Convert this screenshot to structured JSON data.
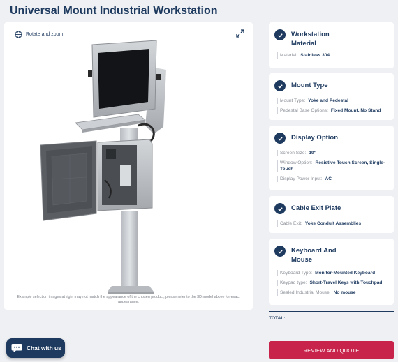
{
  "page": {
    "title": "Universal Mount Industrial Workstation"
  },
  "viewer": {
    "rotate_label": "Rotate and zoom",
    "disclaimer": "Example selection images at right may not match the appearance of the chosen product, please refer to the 3D model above for exact appearance."
  },
  "sections": [
    {
      "title": "Workstation Material",
      "rows": [
        {
          "label": "Material:",
          "value": "Stainless 304"
        }
      ]
    },
    {
      "title": "Mount Type",
      "rows": [
        {
          "label": "Mount Type:",
          "value": "Yoke and Pedestal"
        },
        {
          "label": "Pedestal Base Options:",
          "value": "Fixed Mount, No Stand"
        }
      ]
    },
    {
      "title": "Display Option",
      "rows": [
        {
          "label": "Screen Size:",
          "value": "19\""
        },
        {
          "label": "Window Option:",
          "value": "Resistive Touch Screen, Single-Touch"
        },
        {
          "label": "Display Power Input:",
          "value": "AC"
        }
      ]
    },
    {
      "title": "Cable Exit Plate",
      "rows": [
        {
          "label": "Cable Exit:",
          "value": "Yoke Conduit Assemblies"
        }
      ]
    },
    {
      "title": "Keyboard And Mouse",
      "rows": [
        {
          "label": "Keyboard Type:",
          "value": "Monitor-Mounted Keyboard"
        },
        {
          "label": "Keypad type:",
          "value": "Short-Travel Keys with Touchpad"
        },
        {
          "label": "Sealed Industrial Mouse:",
          "value": "No mouse"
        }
      ]
    }
  ],
  "summary": {
    "total_label": "TOTAL:"
  },
  "actions": {
    "review_label": "REVIEW AND QUOTE",
    "chat_label": "Chat with us"
  },
  "colors": {
    "navy": "#1e3a5f",
    "accent": "#c8234a"
  }
}
